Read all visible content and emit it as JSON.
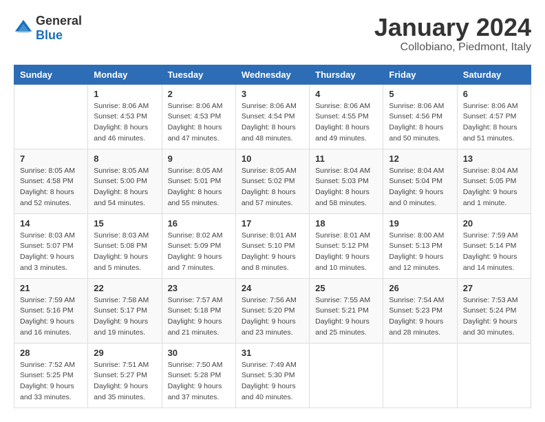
{
  "header": {
    "logo": {
      "general": "General",
      "blue": "Blue"
    },
    "month": "January 2024",
    "location": "Collobiano, Piedmont, Italy"
  },
  "weekdays": [
    "Sunday",
    "Monday",
    "Tuesday",
    "Wednesday",
    "Thursday",
    "Friday",
    "Saturday"
  ],
  "weeks": [
    [
      {
        "day": "",
        "sunrise": "",
        "sunset": "",
        "daylight": ""
      },
      {
        "day": "1",
        "sunrise": "Sunrise: 8:06 AM",
        "sunset": "Sunset: 4:53 PM",
        "daylight": "Daylight: 8 hours and 46 minutes."
      },
      {
        "day": "2",
        "sunrise": "Sunrise: 8:06 AM",
        "sunset": "Sunset: 4:53 PM",
        "daylight": "Daylight: 8 hours and 47 minutes."
      },
      {
        "day": "3",
        "sunrise": "Sunrise: 8:06 AM",
        "sunset": "Sunset: 4:54 PM",
        "daylight": "Daylight: 8 hours and 48 minutes."
      },
      {
        "day": "4",
        "sunrise": "Sunrise: 8:06 AM",
        "sunset": "Sunset: 4:55 PM",
        "daylight": "Daylight: 8 hours and 49 minutes."
      },
      {
        "day": "5",
        "sunrise": "Sunrise: 8:06 AM",
        "sunset": "Sunset: 4:56 PM",
        "daylight": "Daylight: 8 hours and 50 minutes."
      },
      {
        "day": "6",
        "sunrise": "Sunrise: 8:06 AM",
        "sunset": "Sunset: 4:57 PM",
        "daylight": "Daylight: 8 hours and 51 minutes."
      }
    ],
    [
      {
        "day": "7",
        "sunrise": "Sunrise: 8:05 AM",
        "sunset": "Sunset: 4:58 PM",
        "daylight": "Daylight: 8 hours and 52 minutes."
      },
      {
        "day": "8",
        "sunrise": "Sunrise: 8:05 AM",
        "sunset": "Sunset: 5:00 PM",
        "daylight": "Daylight: 8 hours and 54 minutes."
      },
      {
        "day": "9",
        "sunrise": "Sunrise: 8:05 AM",
        "sunset": "Sunset: 5:01 PM",
        "daylight": "Daylight: 8 hours and 55 minutes."
      },
      {
        "day": "10",
        "sunrise": "Sunrise: 8:05 AM",
        "sunset": "Sunset: 5:02 PM",
        "daylight": "Daylight: 8 hours and 57 minutes."
      },
      {
        "day": "11",
        "sunrise": "Sunrise: 8:04 AM",
        "sunset": "Sunset: 5:03 PM",
        "daylight": "Daylight: 8 hours and 58 minutes."
      },
      {
        "day": "12",
        "sunrise": "Sunrise: 8:04 AM",
        "sunset": "Sunset: 5:04 PM",
        "daylight": "Daylight: 9 hours and 0 minutes."
      },
      {
        "day": "13",
        "sunrise": "Sunrise: 8:04 AM",
        "sunset": "Sunset: 5:05 PM",
        "daylight": "Daylight: 9 hours and 1 minute."
      }
    ],
    [
      {
        "day": "14",
        "sunrise": "Sunrise: 8:03 AM",
        "sunset": "Sunset: 5:07 PM",
        "daylight": "Daylight: 9 hours and 3 minutes."
      },
      {
        "day": "15",
        "sunrise": "Sunrise: 8:03 AM",
        "sunset": "Sunset: 5:08 PM",
        "daylight": "Daylight: 9 hours and 5 minutes."
      },
      {
        "day": "16",
        "sunrise": "Sunrise: 8:02 AM",
        "sunset": "Sunset: 5:09 PM",
        "daylight": "Daylight: 9 hours and 7 minutes."
      },
      {
        "day": "17",
        "sunrise": "Sunrise: 8:01 AM",
        "sunset": "Sunset: 5:10 PM",
        "daylight": "Daylight: 9 hours and 8 minutes."
      },
      {
        "day": "18",
        "sunrise": "Sunrise: 8:01 AM",
        "sunset": "Sunset: 5:12 PM",
        "daylight": "Daylight: 9 hours and 10 minutes."
      },
      {
        "day": "19",
        "sunrise": "Sunrise: 8:00 AM",
        "sunset": "Sunset: 5:13 PM",
        "daylight": "Daylight: 9 hours and 12 minutes."
      },
      {
        "day": "20",
        "sunrise": "Sunrise: 7:59 AM",
        "sunset": "Sunset: 5:14 PM",
        "daylight": "Daylight: 9 hours and 14 minutes."
      }
    ],
    [
      {
        "day": "21",
        "sunrise": "Sunrise: 7:59 AM",
        "sunset": "Sunset: 5:16 PM",
        "daylight": "Daylight: 9 hours and 16 minutes."
      },
      {
        "day": "22",
        "sunrise": "Sunrise: 7:58 AM",
        "sunset": "Sunset: 5:17 PM",
        "daylight": "Daylight: 9 hours and 19 minutes."
      },
      {
        "day": "23",
        "sunrise": "Sunrise: 7:57 AM",
        "sunset": "Sunset: 5:18 PM",
        "daylight": "Daylight: 9 hours and 21 minutes."
      },
      {
        "day": "24",
        "sunrise": "Sunrise: 7:56 AM",
        "sunset": "Sunset: 5:20 PM",
        "daylight": "Daylight: 9 hours and 23 minutes."
      },
      {
        "day": "25",
        "sunrise": "Sunrise: 7:55 AM",
        "sunset": "Sunset: 5:21 PM",
        "daylight": "Daylight: 9 hours and 25 minutes."
      },
      {
        "day": "26",
        "sunrise": "Sunrise: 7:54 AM",
        "sunset": "Sunset: 5:23 PM",
        "daylight": "Daylight: 9 hours and 28 minutes."
      },
      {
        "day": "27",
        "sunrise": "Sunrise: 7:53 AM",
        "sunset": "Sunset: 5:24 PM",
        "daylight": "Daylight: 9 hours and 30 minutes."
      }
    ],
    [
      {
        "day": "28",
        "sunrise": "Sunrise: 7:52 AM",
        "sunset": "Sunset: 5:25 PM",
        "daylight": "Daylight: 9 hours and 33 minutes."
      },
      {
        "day": "29",
        "sunrise": "Sunrise: 7:51 AM",
        "sunset": "Sunset: 5:27 PM",
        "daylight": "Daylight: 9 hours and 35 minutes."
      },
      {
        "day": "30",
        "sunrise": "Sunrise: 7:50 AM",
        "sunset": "Sunset: 5:28 PM",
        "daylight": "Daylight: 9 hours and 37 minutes."
      },
      {
        "day": "31",
        "sunrise": "Sunrise: 7:49 AM",
        "sunset": "Sunset: 5:30 PM",
        "daylight": "Daylight: 9 hours and 40 minutes."
      },
      {
        "day": "",
        "sunrise": "",
        "sunset": "",
        "daylight": ""
      },
      {
        "day": "",
        "sunrise": "",
        "sunset": "",
        "daylight": ""
      },
      {
        "day": "",
        "sunrise": "",
        "sunset": "",
        "daylight": ""
      }
    ]
  ]
}
